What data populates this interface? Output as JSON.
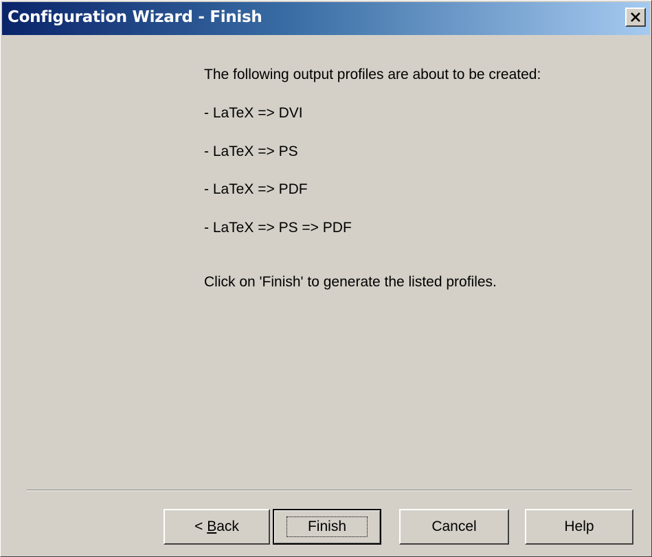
{
  "window": {
    "title": "Configuration Wizard - Finish"
  },
  "content": {
    "intro": "The following output profiles are about to be created:",
    "profiles": [
      "- LaTeX => DVI",
      "- LaTeX => PS",
      "- LaTeX => PDF",
      "- LaTeX => PS => PDF"
    ],
    "instruction": "Click on 'Finish' to generate the listed profiles."
  },
  "buttons": {
    "back_prefix": "< ",
    "back_mnemonic": "B",
    "back_rest": "ack",
    "finish": "Finish",
    "cancel": "Cancel",
    "help": "Help"
  },
  "icons": {
    "close": "close-icon"
  },
  "colors": {
    "title_start": "#0a246a",
    "title_end": "#a6caf0",
    "dialog_bg": "#d4d0c8"
  }
}
